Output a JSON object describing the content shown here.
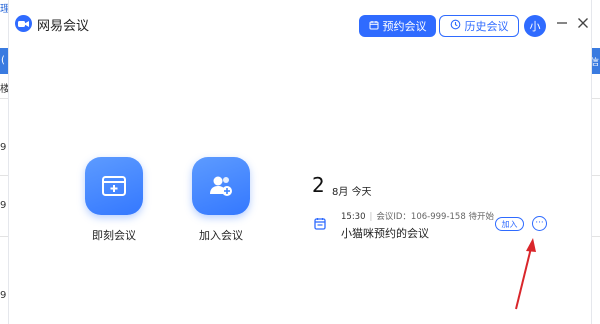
{
  "background_app": {
    "tab_text": "理信息",
    "bar_text": "(",
    "left_items": [
      "楼",
      "9",
      "9",
      "9"
    ],
    "right_bar_text": "信"
  },
  "window": {
    "app_title": "网易会议",
    "schedule_button": "预约会议",
    "history_button": "历史会议",
    "avatar_text": "小",
    "accent_color": "#2f6bff"
  },
  "actions": [
    {
      "label": "即刻会议",
      "icon": "instant-meeting-icon"
    },
    {
      "label": "加入会议",
      "icon": "join-meeting-icon"
    }
  ],
  "meeting_list": {
    "date_day": "2",
    "date_month": "8月",
    "date_relative": "今天",
    "meetings": [
      {
        "time": "15:30",
        "meeting_id": "会议ID：106-999-158",
        "status": "待开始",
        "title": "小猫咪预约的会议",
        "join_label": "加入",
        "more_label": "···"
      }
    ]
  },
  "annotation": {
    "arrow_color": "#d9262b"
  }
}
